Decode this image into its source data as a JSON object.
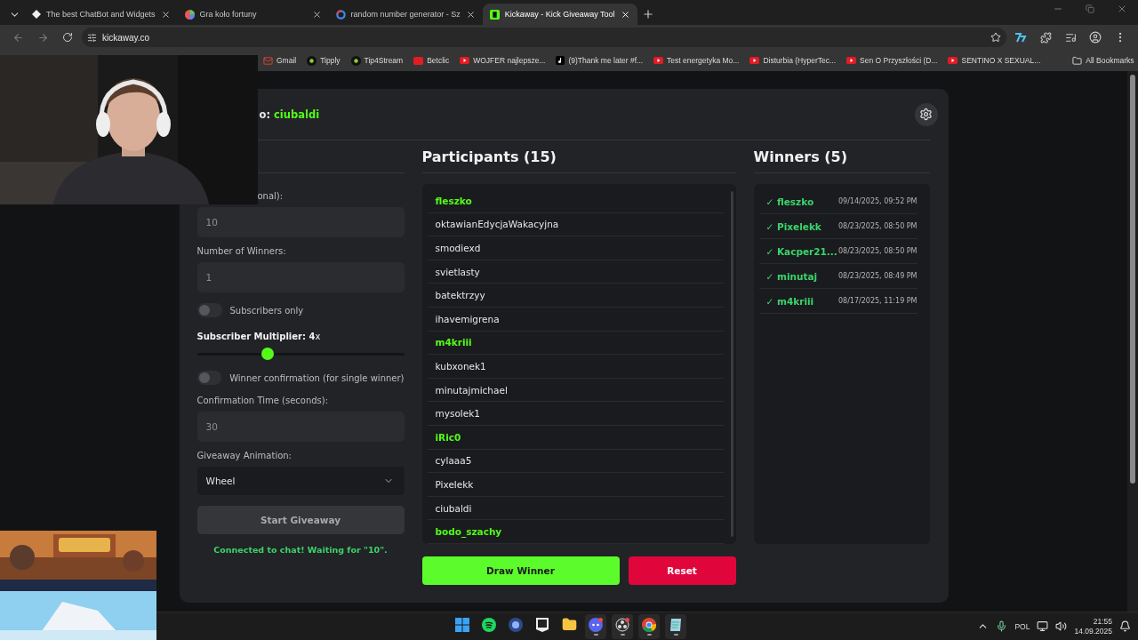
{
  "browser": {
    "tabs": [
      {
        "title": "The best ChatBot and Widgets",
        "selected": false
      },
      {
        "title": "Gra koło fortuny",
        "selected": false
      },
      {
        "title": "random number generator - Sz",
        "selected": false
      },
      {
        "title": "Kickaway - Kick Giveaway Tool",
        "selected": true
      }
    ],
    "address": "kickaway.co",
    "bookmarks": [
      {
        "label": "Gmail"
      },
      {
        "label": "Tipply"
      },
      {
        "label": "Tip4Stream"
      },
      {
        "label": "Betclic"
      },
      {
        "label": "WOJFER najlepsze..."
      },
      {
        "label": "(9)Thank me later #f..."
      },
      {
        "label": "Test energetyka Mo..."
      },
      {
        "label": "Disturbia (HyperTec..."
      },
      {
        "label": "Sen O Przyszłości (D..."
      },
      {
        "label": "SENTINO X SEXUAL..."
      }
    ],
    "all_bookmarks": "All Bookmarks"
  },
  "header": {
    "prefix": "o:",
    "channel": "ciubaldi"
  },
  "settings": {
    "controls": [
      {
        "kind": "input",
        "label": "onal):",
        "placeholder": "10"
      },
      {
        "kind": "input",
        "label": "Number of Winners:",
        "placeholder": "1"
      },
      {
        "kind": "toggle",
        "label": "Subscribers only",
        "on": false
      },
      {
        "kind": "slider",
        "label": "**Subscriber Multiplier: 4**x",
        "level": 0.34
      },
      {
        "kind": "toggle",
        "label": "Winner confirmation (for single winner)",
        "on": false
      },
      {
        "kind": "input",
        "label": "Confirmation Time (seconds):",
        "placeholder": "30"
      },
      {
        "kind": "select",
        "label": "Giveaway Animation:",
        "value": "Wheel"
      }
    ],
    "start_button": {
      "label": "Start Giveaway",
      "disabled": true
    },
    "status": "Connected to chat! Waiting for \"10\"."
  },
  "participants": {
    "title": "Participants (15)",
    "items": [
      {
        "name": "fleszko",
        "subscriber": true
      },
      {
        "name": "oktawianEdycjaWakacyjna",
        "subscriber": false
      },
      {
        "name": "smodiexd",
        "subscriber": false
      },
      {
        "name": "svietlasty",
        "subscriber": false
      },
      {
        "name": "batektrzyy",
        "subscriber": false
      },
      {
        "name": "ihavemigrena",
        "subscriber": false
      },
      {
        "name": "m4kriii",
        "subscriber": true
      },
      {
        "name": "kubxonek1",
        "subscriber": false
      },
      {
        "name": "minutajmichael",
        "subscriber": false
      },
      {
        "name": "mysolek1",
        "subscriber": false
      },
      {
        "name": "iRic0",
        "subscriber": true
      },
      {
        "name": "cylaaa5",
        "subscriber": false
      },
      {
        "name": "Pixelekk",
        "subscriber": false
      },
      {
        "name": "ciubaldi",
        "subscriber": false
      },
      {
        "name": "bodo_szachy",
        "subscriber": true
      }
    ],
    "draw_button": "Draw Winner",
    "reset_button": "Reset"
  },
  "winners": {
    "title": "Winners (5)",
    "items": [
      {
        "check": "✓",
        "name": "fleszko",
        "time": "09/14/2025, 09:52 PM"
      },
      {
        "check": "✓",
        "name": "Pixelekk",
        "time": "08/23/2025, 08:50 PM"
      },
      {
        "check": "✓",
        "name": "Kacper21...",
        "time": "08/23/2025, 08:50 PM"
      },
      {
        "check": "✓",
        "name": "minutaj",
        "time": "08/23/2025, 08:49 PM"
      },
      {
        "check": "✓",
        "name": "m4kriii",
        "time": "08/17/2025, 11:19 PM"
      }
    ]
  },
  "taskbar": {
    "apps": [
      {
        "running": false
      },
      {
        "running": false
      },
      {
        "running": false
      },
      {
        "running": false
      },
      {
        "running": false
      },
      {
        "running": true
      },
      {
        "running": true
      },
      {
        "running": true
      },
      {
        "running": true
      }
    ],
    "language": "POL",
    "time": "21:55",
    "date": "14.09.2025"
  }
}
